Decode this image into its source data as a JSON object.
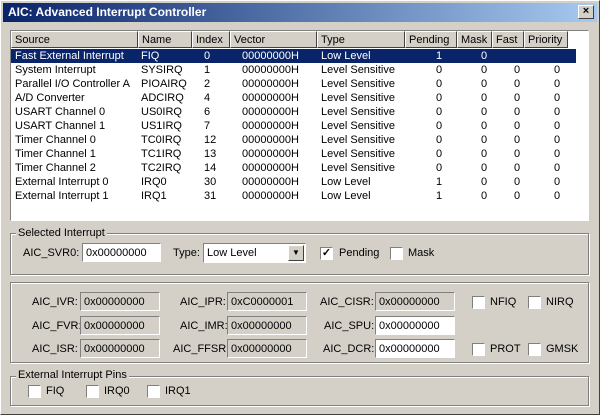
{
  "window": {
    "title": "AIC: Advanced Interrupt Controller",
    "close_glyph": "×"
  },
  "table": {
    "columns": [
      "Source",
      "Name",
      "Index",
      "Vector",
      "Type",
      "Pending",
      "Mask",
      "Fast",
      "Priority"
    ],
    "rows": [
      {
        "source": "Fast External Interrupt",
        "name": "FIQ",
        "index": "0",
        "vector": "00000000H",
        "type": "Low Level",
        "pending": "1",
        "mask": "0",
        "fast": "",
        "priority": "",
        "selected": true
      },
      {
        "source": "System Interrupt",
        "name": "SYSIRQ",
        "index": "1",
        "vector": "00000000H",
        "type": "Level Sensitive",
        "pending": "0",
        "mask": "0",
        "fast": "0",
        "priority": "0"
      },
      {
        "source": "Parallel I/O Controller A",
        "name": "PIOAIRQ",
        "index": "2",
        "vector": "00000000H",
        "type": "Level Sensitive",
        "pending": "0",
        "mask": "0",
        "fast": "0",
        "priority": "0"
      },
      {
        "source": "A/D Converter",
        "name": "ADCIRQ",
        "index": "4",
        "vector": "00000000H",
        "type": "Level Sensitive",
        "pending": "0",
        "mask": "0",
        "fast": "0",
        "priority": "0"
      },
      {
        "source": "USART Channel 0",
        "name": "US0IRQ",
        "index": "6",
        "vector": "00000000H",
        "type": "Level Sensitive",
        "pending": "0",
        "mask": "0",
        "fast": "0",
        "priority": "0"
      },
      {
        "source": "USART Channel 1",
        "name": "US1IRQ",
        "index": "7",
        "vector": "00000000H",
        "type": "Level Sensitive",
        "pending": "0",
        "mask": "0",
        "fast": "0",
        "priority": "0"
      },
      {
        "source": "Timer Channel 0",
        "name": "TC0IRQ",
        "index": "12",
        "vector": "00000000H",
        "type": "Level Sensitive",
        "pending": "0",
        "mask": "0",
        "fast": "0",
        "priority": "0"
      },
      {
        "source": "Timer Channel 1",
        "name": "TC1IRQ",
        "index": "13",
        "vector": "00000000H",
        "type": "Level Sensitive",
        "pending": "0",
        "mask": "0",
        "fast": "0",
        "priority": "0"
      },
      {
        "source": "Timer Channel 2",
        "name": "TC2IRQ",
        "index": "14",
        "vector": "00000000H",
        "type": "Level Sensitive",
        "pending": "0",
        "mask": "0",
        "fast": "0",
        "priority": "0"
      },
      {
        "source": "External Interrupt 0",
        "name": "IRQ0",
        "index": "30",
        "vector": "00000000H",
        "type": "Low Level",
        "pending": "1",
        "mask": "0",
        "fast": "0",
        "priority": "0"
      },
      {
        "source": "External Interrupt 1",
        "name": "IRQ1",
        "index": "31",
        "vector": "00000000H",
        "type": "Low Level",
        "pending": "1",
        "mask": "0",
        "fast": "0",
        "priority": "0"
      }
    ]
  },
  "selected": {
    "group_label": "Selected Interrupt",
    "svr0_label": "AIC_SVR0:",
    "svr0_value": "0x00000000",
    "type_label": "Type:",
    "type_value": "Low Level",
    "pending_label": "Pending",
    "pending_checked": true,
    "check_glyph": "✓",
    "mask_label": "Mask",
    "mask_checked": false
  },
  "registers": {
    "ivr_label": "AIC_IVR:",
    "ivr_value": "0x00000000",
    "ipr_label": "AIC_IPR:",
    "ipr_value": "0xC0000001",
    "cisr_label": "AIC_CISR:",
    "cisr_value": "0x00000000",
    "nfiq_label": "NFIQ",
    "nirq_label": "NIRQ",
    "fvr_label": "AIC_FVR:",
    "fvr_value": "0x00000000",
    "imr_label": "AIC_IMR:",
    "imr_value": "0x00000000",
    "spu_label": "AIC_SPU:",
    "spu_value": "0x00000000",
    "isr_label": "AIC_ISR:",
    "isr_value": "0x00000000",
    "ffsr_label": "AIC_FFSR:",
    "ffsr_value": "0x00000000",
    "dcr_label": "AIC_DCR:",
    "dcr_value": "0x00000000",
    "prot_label": "PROT",
    "gmsk_label": "GMSK"
  },
  "pins": {
    "group_label": "External Interrupt Pins",
    "fiq_label": "FIQ",
    "irq0_label": "IRQ0",
    "irq1_label": "IRQ1"
  },
  "colors": {
    "selection": "#0a246a",
    "face": "#d4d0c8"
  },
  "icons": {
    "close": "close-icon",
    "dropdown": "chevron-down-icon"
  }
}
